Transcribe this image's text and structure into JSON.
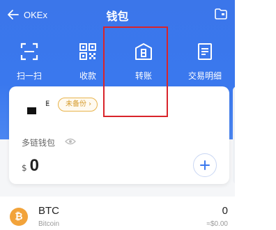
{
  "topbar": {
    "back_label": "OKEx",
    "title": "钱包",
    "folder_icon": "folder-icon"
  },
  "actions": [
    {
      "label": "扫一扫",
      "icon": "scan-icon"
    },
    {
      "label": "收款",
      "icon": "qr-code-icon"
    },
    {
      "label": "转账",
      "icon": "transfer-icon"
    },
    {
      "label": "交易明细",
      "icon": "document-icon"
    }
  ],
  "wallet": {
    "bug_glyph": "ⵟ",
    "backup_badge": "未备份 ›",
    "name": "多链钱包",
    "currency": "$",
    "balance": "0"
  },
  "asset": {
    "symbol": "BTC",
    "name": "Bitcoin",
    "amount": "0",
    "fiat": "≈$0.00",
    "coin_glyph": "₿"
  },
  "colors": {
    "primary": "#3a78ee",
    "badge": "#e8b34b",
    "highlight": "#d9242a",
    "bitcoin": "#f2a33a"
  }
}
